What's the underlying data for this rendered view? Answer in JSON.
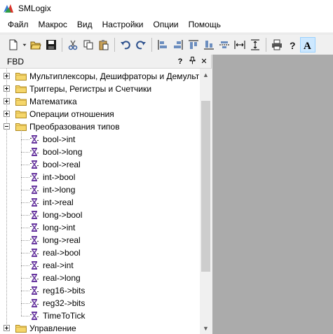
{
  "window": {
    "title": "SMLogix"
  },
  "menu": [
    "Файл",
    "Макрос",
    "Вид",
    "Настройки",
    "Опции",
    "Помощь"
  ],
  "panel": {
    "title": "FBD",
    "help_glyph": "?",
    "pin_glyph": "ᵩ",
    "close_glyph": "✕"
  },
  "tree": {
    "folders": [
      {
        "label": "Мультиплексоры, Дешифраторы и Демультиплексоры",
        "expanded": false
      },
      {
        "label": "Триггеры, Регистры и Счетчики",
        "expanded": false
      },
      {
        "label": "Математика",
        "expanded": false
      },
      {
        "label": "Операции отношения",
        "expanded": false
      },
      {
        "label": "Преобразования типов",
        "expanded": true,
        "children": [
          "bool->int",
          "bool->long",
          "bool->real",
          "int->bool",
          "int->long",
          "int->real",
          "long->bool",
          "long->int",
          "long->real",
          "real->bool",
          "real->int",
          "real->long",
          "reg16->bits",
          "reg32->bits",
          "TimeToTick"
        ]
      },
      {
        "label": "Управление",
        "expanded": false
      }
    ]
  },
  "scrollbar": {
    "up": "▲",
    "down": "▼"
  },
  "colors": {
    "canvas": "#ababab",
    "folder": "#f5d66b",
    "leaf_icon": "#6a3aa0"
  },
  "toolbar_icons": [
    "new-file-icon",
    "dropdown-icon",
    "open-folder-icon",
    "save-icon",
    "cut-icon",
    "copy-icon",
    "paste-icon",
    "undo-icon",
    "redo-icon",
    "align-left-icon",
    "align-right-icon",
    "align-top-icon",
    "align-bottom-icon",
    "center-vertical-icon",
    "same-width-icon",
    "same-height-icon",
    "print-icon",
    "help-icon",
    "text-icon"
  ]
}
